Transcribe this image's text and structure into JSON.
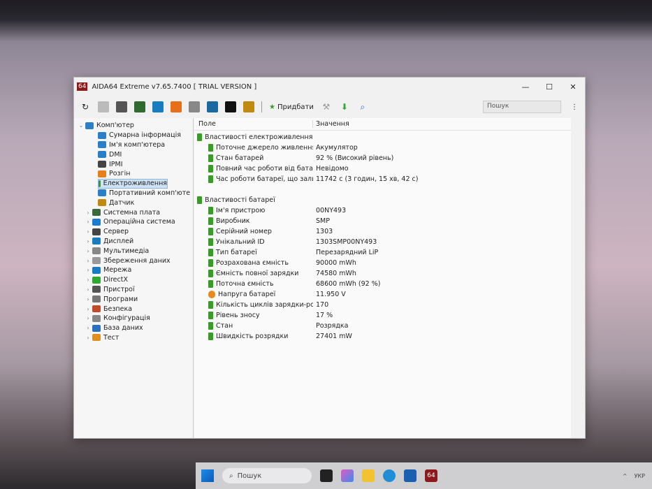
{
  "window": {
    "title": "AIDA64 Extreme v7.65.7400  [ TRIAL VERSION ]",
    "logo": "64",
    "minimize": "—",
    "maximize": "☐",
    "close": "✕"
  },
  "toolbar": {
    "buy_label": "Придбати",
    "search_placeholder": "Пошук",
    "more": "⋮",
    "icons": [
      "refresh-icon",
      "report-icon",
      "motherboard-icon",
      "memory-icon",
      "network-icon",
      "overclock-icon",
      "config-icon",
      "user-icon",
      "osd-icon",
      "sensor-icon"
    ]
  },
  "tree": {
    "root": "Комп'ютер",
    "children": [
      "Сумарна інформація",
      "Ім'я комп'ютера",
      "DMI",
      "IPMI",
      "Розгін",
      "Електроживлення",
      "Портативний комп'юте",
      "Датчик"
    ],
    "sections": [
      "Системна плата",
      "Операційна система",
      "Сервер",
      "Дисплей",
      "Мультимедіа",
      "Збереження даних",
      "Мережа",
      "DirectX",
      "Пристрої",
      "Програми",
      "Безпека",
      "Конфігурація",
      "База даних",
      "Тест"
    ]
  },
  "list": {
    "col_field": "Поле",
    "col_value": "Значення",
    "groups": [
      {
        "name": "Властивості електроживлення",
        "rows": [
          {
            "field": "Поточне джерело живлення",
            "value": "Акумулятор"
          },
          {
            "field": "Стан батарей",
            "value": "92 % (Високий рівень)"
          },
          {
            "field": "Повний час роботи від батареї",
            "value": "Невідомо"
          },
          {
            "field": "Час роботи батареї, що залиш...",
            "value": "11742 с (3 годин, 15 хв, 42 с)"
          }
        ]
      },
      {
        "name": "Властивості батареї",
        "rows": [
          {
            "field": "Ім'я пристрою",
            "value": "00NY493"
          },
          {
            "field": "Виробник",
            "value": "SMP"
          },
          {
            "field": "Серійний номер",
            "value": "1303"
          },
          {
            "field": "Унікальний ID",
            "value": "1303SMP00NY493"
          },
          {
            "field": "Тип батареї",
            "value": "Перезарядний LiP"
          },
          {
            "field": "Розрахована ємність",
            "value": "90000 mWh"
          },
          {
            "field": "Ємність повної зарядки",
            "value": "74580 mWh"
          },
          {
            "field": "Поточна ємність",
            "value": "68600 mWh  (92 %)"
          },
          {
            "field": "Напруга батареї",
            "value": "11.950 V"
          },
          {
            "field": "Кількість циклів зарядки-розря...",
            "value": "170"
          },
          {
            "field": "Рівень зносу",
            "value": "17 %"
          },
          {
            "field": "Стан",
            "value": "Розрядка"
          },
          {
            "field": "Швидкість розрядки",
            "value": "27401 mW"
          }
        ]
      }
    ]
  },
  "taskbar": {
    "search": "Пошук",
    "aida": "64",
    "lang": "УКР"
  }
}
